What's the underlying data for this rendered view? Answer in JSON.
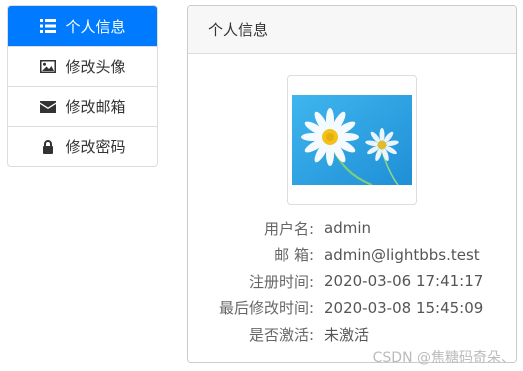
{
  "sidebar": {
    "items": [
      {
        "label": "个人信息",
        "icon": "list-icon",
        "active": true
      },
      {
        "label": "修改头像",
        "icon": "image-icon",
        "active": false
      },
      {
        "label": "修改邮箱",
        "icon": "envelope-icon",
        "active": false
      },
      {
        "label": "修改密码",
        "icon": "lock-icon",
        "active": false
      }
    ]
  },
  "panel": {
    "title": "个人信息",
    "avatar_icon": "daisy-avatar-image",
    "fields": [
      {
        "label": "用户名:",
        "value": "admin"
      },
      {
        "label": "邮 箱:",
        "value": "admin@lightbbs.test"
      },
      {
        "label": "注册时间:",
        "value": "2020-03-06 17:41:17"
      },
      {
        "label": "最后修改时间:",
        "value": "2020-03-08 15:45:09"
      },
      {
        "label": "是否激活:",
        "value": "未激活"
      }
    ]
  },
  "watermark": "CSDN @焦糖码奇朵、",
  "colors": {
    "accent": "#007bff",
    "border": "#dddddd",
    "panel_head_bg": "#f7f7f7"
  }
}
